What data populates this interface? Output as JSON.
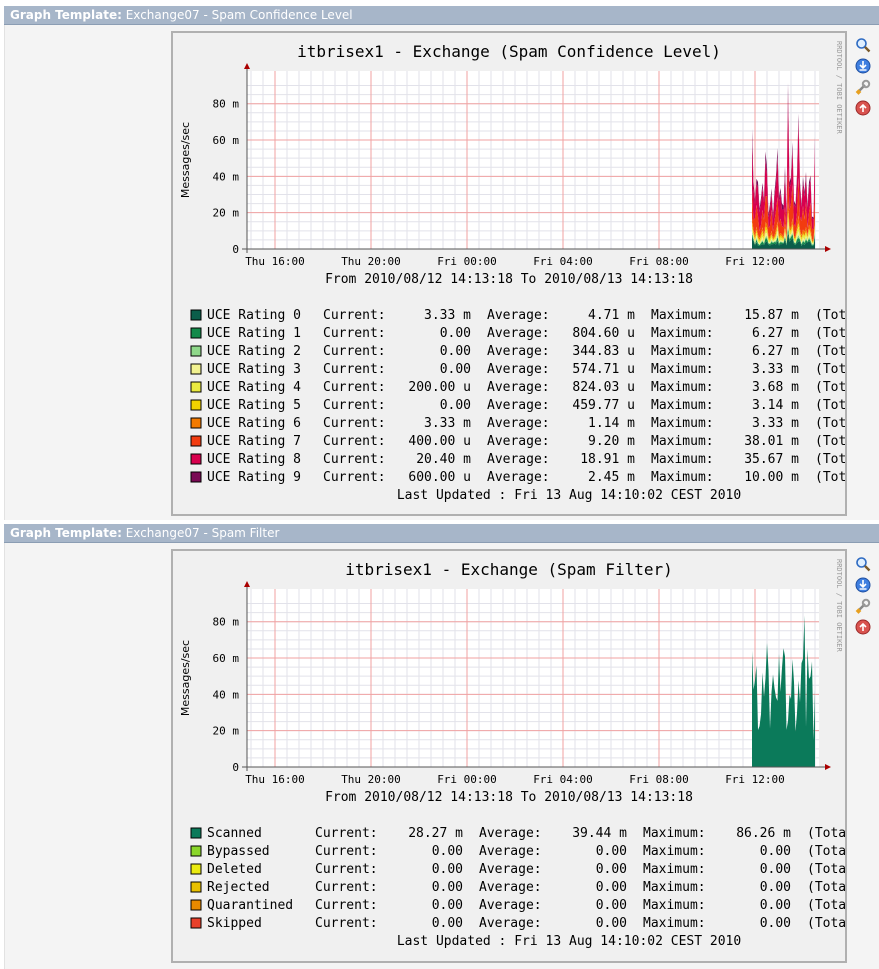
{
  "graphs": [
    {
      "template_label": "Graph Template:",
      "template_name": "Exchange07 - Spam Confidence Level",
      "title": "itbrisex1 - Exchange (Spam Confidence Level)",
      "ylabel": "Messages/sec",
      "side_text": "RRDTOOL / TOBI OETIKER",
      "y_ticks": [
        "0",
        "20 m",
        "40 m",
        "60 m",
        "80 m"
      ],
      "x_ticks": [
        "Thu 16:00",
        "Thu 20:00",
        "Fri 00:00",
        "Fri 04:00",
        "Fri 08:00",
        "Fri 12:00"
      ],
      "range_text": "From 2010/08/12 14:13:18 To 2010/08/13 14:13:18",
      "last_updated": "Last Updated : Fri 13 Aug 14:10:02 CEST 2010",
      "legend": [
        {
          "name": "UCE Rating 0",
          "color": "#0b5e4a",
          "current": "3.33 m",
          "average": "4.71 m",
          "maximum": "15.87 m",
          "total": "(Tota"
        },
        {
          "name": "UCE Rating 1",
          "color": "#138a4a",
          "current": "0.00",
          "average": "804.60 u",
          "maximum": "6.27 m",
          "total": "(Tota"
        },
        {
          "name": "UCE Rating 2",
          "color": "#8fd88a",
          "current": "0.00",
          "average": "344.83 u",
          "maximum": "6.27 m",
          "total": "(Tota"
        },
        {
          "name": "UCE Rating 3",
          "color": "#f2f290",
          "current": "0.00",
          "average": "574.71 u",
          "maximum": "3.33 m",
          "total": "(Tota"
        },
        {
          "name": "UCE Rating 4",
          "color": "#eaea40",
          "current": "200.00 u",
          "average": "824.03 u",
          "maximum": "3.68 m",
          "total": "(Tota"
        },
        {
          "name": "UCE Rating 5",
          "color": "#f2d200",
          "current": "0.00",
          "average": "459.77 u",
          "maximum": "3.14 m",
          "total": "(Tota"
        },
        {
          "name": "UCE Rating 6",
          "color": "#f27a00",
          "current": "3.33 m",
          "average": "1.14 m",
          "maximum": "3.33 m",
          "total": "(Tota"
        },
        {
          "name": "UCE Rating 7",
          "color": "#f23c10",
          "current": "400.00 u",
          "average": "9.20 m",
          "maximum": "38.01 m",
          "total": "(Tota"
        },
        {
          "name": "UCE Rating 8",
          "color": "#d8004e",
          "current": "20.40 m",
          "average": "18.91 m",
          "maximum": "35.67 m",
          "total": "(Tota"
        },
        {
          "name": "UCE Rating 9",
          "color": "#7a0a55",
          "current": "600.00 u",
          "average": "2.45 m",
          "maximum": "10.00 m",
          "total": "(Tota"
        }
      ]
    },
    {
      "template_label": "Graph Template:",
      "template_name": "Exchange07 - Spam Filter",
      "title": "itbrisex1 - Exchange (Spam Filter)",
      "ylabel": "Messages/sec",
      "side_text": "RRDTOOL / TOBI OETIKER",
      "y_ticks": [
        "0",
        "20 m",
        "40 m",
        "60 m",
        "80 m"
      ],
      "x_ticks": [
        "Thu 16:00",
        "Thu 20:00",
        "Fri 00:00",
        "Fri 04:00",
        "Fri 08:00",
        "Fri 12:00"
      ],
      "range_text": "From 2010/08/12 14:13:18 To 2010/08/13 14:13:18",
      "last_updated": "Last Updated : Fri 13 Aug 14:10:02 CEST 2010",
      "legend": [
        {
          "name": "Scanned",
          "color": "#0b7a5a",
          "current": "28.27 m",
          "average": "39.44 m",
          "maximum": "86.26 m",
          "total": "(Tota"
        },
        {
          "name": "Bypassed",
          "color": "#8ad62a",
          "current": "0.00",
          "average": "0.00",
          "maximum": "0.00",
          "total": "(Tota"
        },
        {
          "name": "Deleted",
          "color": "#eaea10",
          "current": "0.00",
          "average": "0.00",
          "maximum": "0.00",
          "total": "(Tota"
        },
        {
          "name": "Rejected",
          "color": "#e8c000",
          "current": "0.00",
          "average": "0.00",
          "maximum": "0.00",
          "total": "(Tota"
        },
        {
          "name": "Quarantined",
          "color": "#e88a00",
          "current": "0.00",
          "average": "0.00",
          "maximum": "0.00",
          "total": "(Tota"
        },
        {
          "name": "Skipped",
          "color": "#e8402a",
          "current": "0.00",
          "average": "0.00",
          "maximum": "0.00",
          "total": "(Tota"
        }
      ]
    }
  ],
  "legend_labels": {
    "current": "Current:",
    "average": "Average:",
    "maximum": "Maximum:"
  },
  "icons": [
    "zoom-icon",
    "csv-export-icon",
    "properties-icon",
    "move-up-icon"
  ],
  "chart_data": [
    {
      "type": "area",
      "title": "itbrisex1 - Exchange (Spam Confidence Level)",
      "ylabel": "Messages/sec",
      "ylim": [
        0,
        0.098
      ],
      "x_range": [
        "2010/08/12 14:13:18",
        "2010/08/13 14:13:18"
      ],
      "stacked": true,
      "activity_start": "Fri 12:00",
      "peak_total": 0.086,
      "series": [
        {
          "name": "UCE Rating 0",
          "current": 0.00333,
          "average": 0.00471,
          "maximum": 0.01587
        },
        {
          "name": "UCE Rating 1",
          "current": 0,
          "average": 0.0008046,
          "maximum": 0.00627
        },
        {
          "name": "UCE Rating 2",
          "current": 0,
          "average": 0.00034483,
          "maximum": 0.00627
        },
        {
          "name": "UCE Rating 3",
          "current": 0,
          "average": 0.00057471,
          "maximum": 0.00333
        },
        {
          "name": "UCE Rating 4",
          "current": 0.0002,
          "average": 0.00082403,
          "maximum": 0.00368
        },
        {
          "name": "UCE Rating 5",
          "current": 0,
          "average": 0.00045977,
          "maximum": 0.00314
        },
        {
          "name": "UCE Rating 6",
          "current": 0.00333,
          "average": 0.00114,
          "maximum": 0.00333
        },
        {
          "name": "UCE Rating 7",
          "current": 0.0004,
          "average": 0.0092,
          "maximum": 0.03801
        },
        {
          "name": "UCE Rating 8",
          "current": 0.0204,
          "average": 0.01891,
          "maximum": 0.03567
        },
        {
          "name": "UCE Rating 9",
          "current": 0.0006,
          "average": 0.00245,
          "maximum": 0.01
        }
      ]
    },
    {
      "type": "area",
      "title": "itbrisex1 - Exchange (Spam Filter)",
      "ylabel": "Messages/sec",
      "ylim": [
        0,
        0.098
      ],
      "x_range": [
        "2010/08/12 14:13:18",
        "2010/08/13 14:13:18"
      ],
      "stacked": true,
      "activity_start": "Fri 12:00",
      "peak_total": 0.08626,
      "series": [
        {
          "name": "Scanned",
          "current": 0.02827,
          "average": 0.03944,
          "maximum": 0.08626
        },
        {
          "name": "Bypassed",
          "current": 0,
          "average": 0,
          "maximum": 0
        },
        {
          "name": "Deleted",
          "current": 0,
          "average": 0,
          "maximum": 0
        },
        {
          "name": "Rejected",
          "current": 0,
          "average": 0,
          "maximum": 0
        },
        {
          "name": "Quarantined",
          "current": 0,
          "average": 0,
          "maximum": 0
        },
        {
          "name": "Skipped",
          "current": 0,
          "average": 0,
          "maximum": 0
        }
      ]
    }
  ]
}
